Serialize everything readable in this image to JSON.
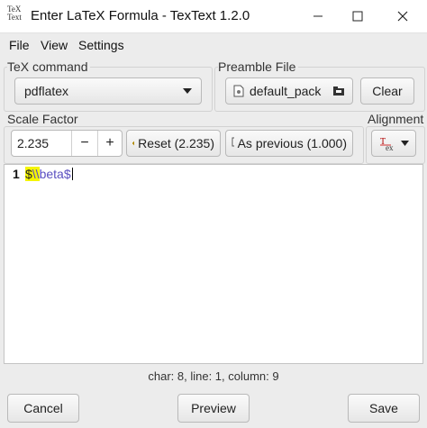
{
  "window": {
    "icon_text": "TeX Text",
    "title": "Enter LaTeX Formula - TexText 1.2.0",
    "minimize_icon": "minimize-icon",
    "maximize_icon": "maximize-icon",
    "close_icon": "close-icon"
  },
  "menu": {
    "file": "File",
    "view": "View",
    "settings": "Settings"
  },
  "tex_command": {
    "label": "TeX command",
    "selected": "pdflatex",
    "icon": "chevron-down-icon"
  },
  "preamble": {
    "label": "Preamble File",
    "file": "default_pack",
    "clear": "Clear"
  },
  "scale": {
    "label": "Scale Factor",
    "value": "2.235",
    "minus": "−",
    "plus": "+",
    "reset": "Reset (2.235)",
    "as_previous": "As previous (1.000)"
  },
  "alignment": {
    "label": "Alignment",
    "icon": "alignment-icon"
  },
  "editor": {
    "line_number": "1",
    "code_dollar_open": "$",
    "code_backslashes": "\\\\",
    "code_word": "beta",
    "code_dollar_close": "$",
    "highlight_color": "#f5f500",
    "keyword_color": "#5a4fc0"
  },
  "status": "char: 8, line: 1, column: 9",
  "buttons": {
    "cancel": "Cancel",
    "preview": "Preview",
    "save": "Save"
  }
}
